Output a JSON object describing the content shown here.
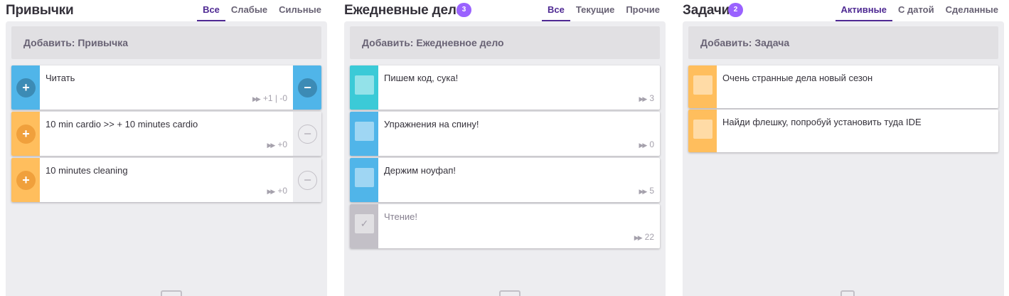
{
  "habits": {
    "title": "Привычки",
    "filters": [
      "Все",
      "Слабые",
      "Сильные"
    ],
    "add_label": "Добавить: Привычка",
    "items": [
      {
        "text": "Читать",
        "stat": "+1 | -0",
        "plus": "+",
        "minus": "−"
      },
      {
        "text": "10 min cardio >> + 10 minutes cardio",
        "stat": "+0",
        "plus": "+",
        "minus": "−"
      },
      {
        "text": "10 minutes cleaning",
        "stat": "+0",
        "plus": "+",
        "minus": "−"
      }
    ],
    "bottom_icon": "habit-icon"
  },
  "dailies": {
    "title": "Ежедневные дела",
    "badge": "3",
    "filters": [
      "Все",
      "Текущие",
      "Прочие"
    ],
    "add_label": "Добавить: Ежедневное дело",
    "items": [
      {
        "text": "Пишем код, сука!",
        "stat": "3"
      },
      {
        "text": "Упражнения на спину!",
        "stat": "0"
      },
      {
        "text": "Держим ноуфап!",
        "stat": "5"
      },
      {
        "text": "Чтение!",
        "stat": "22",
        "check": "✓"
      }
    ],
    "bottom_icon": "calendar-icon"
  },
  "todos": {
    "title": "Задачи",
    "badge": "2",
    "filters": [
      "Активные",
      "С датой",
      "Сделанные"
    ],
    "add_label": "Добавить: Задача",
    "items": [
      {
        "text": "Очень странные дела новый сезон"
      },
      {
        "text": "Найди флешку, попробуй установить туда IDE"
      }
    ],
    "bottom_icon": "checklist-icon"
  },
  "icons": {
    "fast_forward": "▶▶"
  },
  "colors": {
    "accent": "#4f2a93",
    "badge": "#9a62ff",
    "habit_blue": "#50b5e9",
    "habit_blue_dark": "#3c8bb5",
    "habit_orange": "#ffbe5d",
    "habit_orange_dark": "#f0a03c",
    "daily_teal": "#3bcad7",
    "daily_blue": "#50b5e9",
    "daily_done": "#c3c0c7"
  }
}
